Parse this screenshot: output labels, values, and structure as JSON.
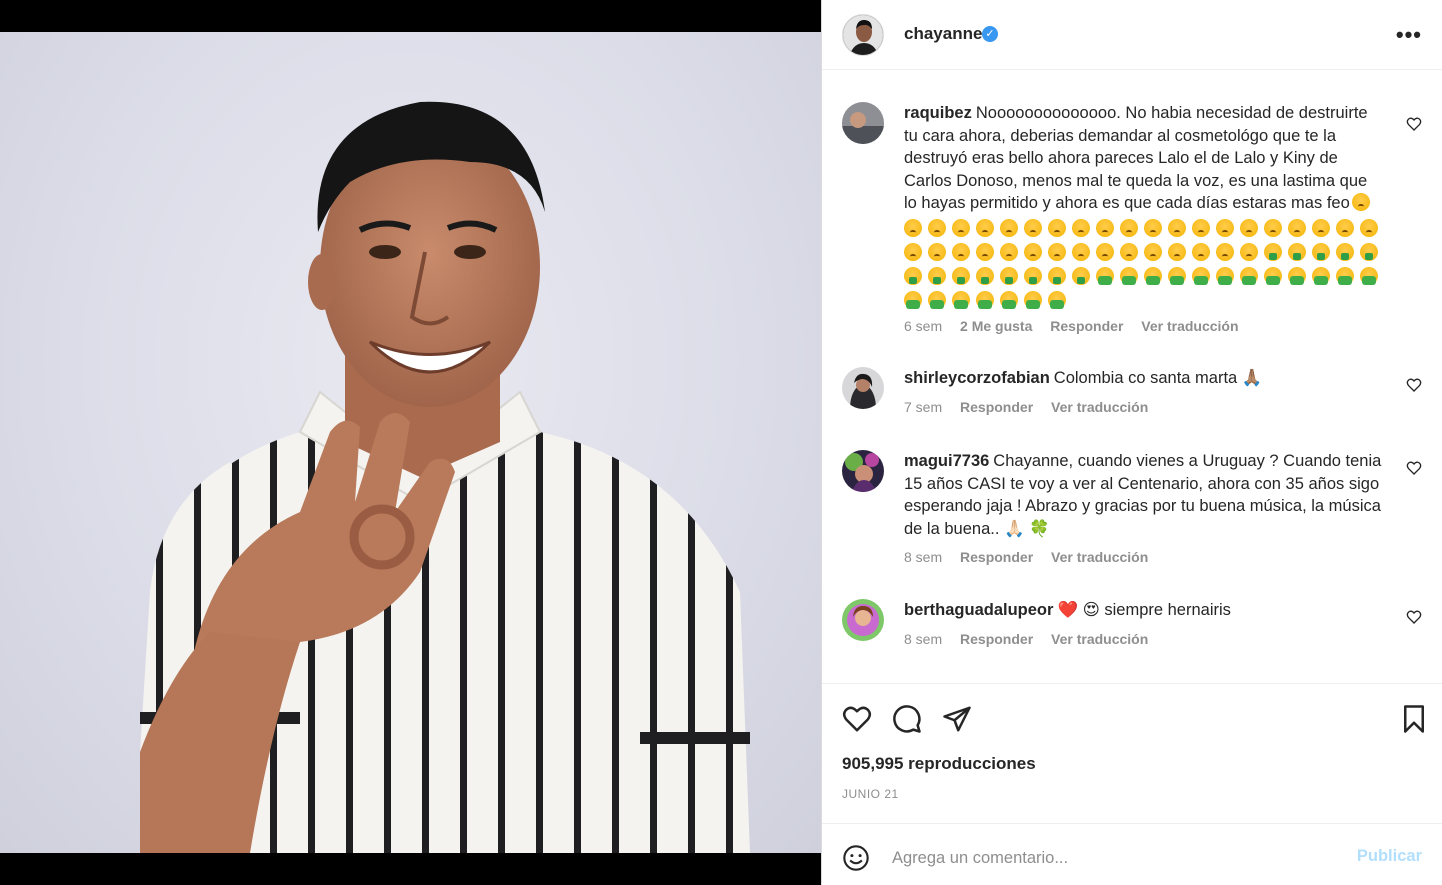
{
  "post": {
    "username": "chayanne",
    "verified_icon": "verified-badge-icon",
    "more_icon": "ellipsis-icon"
  },
  "comments": [
    {
      "username": "raquibez",
      "text": "Noooooooooooooo. No habia necesidad de destruirte tu cara ahora, deberias demandar al cosmetológo que te la destruyó eras bello ahora pareces Lalo el de Lalo y Kiny de Carlos Donoso, menos mal te queda la voz, es una lastima que lo hayas permitido y ahora es que cada días estaras mas feo",
      "emoji_rows": [
        [
          "sad",
          "sad",
          "sad",
          "sad",
          "sad",
          "sad",
          "sad",
          "sad",
          "sad",
          "sad",
          "sad",
          "sad",
          "sad",
          "sad",
          "sad",
          "sad",
          "sad",
          "sad",
          "sad",
          "sad"
        ],
        [
          "sad",
          "sad",
          "sad",
          "sad",
          "sad",
          "sad",
          "sad",
          "sad",
          "sad",
          "sad",
          "sad",
          "sad",
          "sad",
          "sad",
          "sad",
          "money",
          "money",
          "money",
          "money",
          "money"
        ],
        [
          "money",
          "money",
          "money",
          "money",
          "money",
          "money",
          "money",
          "money",
          "sick",
          "sick",
          "sick",
          "sick",
          "sick",
          "sick",
          "sick",
          "sick",
          "sick",
          "sick",
          "sick",
          "sick"
        ],
        [
          "sick",
          "sick",
          "sick",
          "sick",
          "sick",
          "sick",
          "sick"
        ]
      ],
      "time": "6 sem",
      "likes": "2 Me gusta",
      "reply": "Responder",
      "translate": "Ver traducción"
    },
    {
      "username": "shirleycorzofabian",
      "text": "Colombia co santa marta 🙏🏽",
      "time": "7 sem",
      "reply": "Responder",
      "translate": "Ver traducción"
    },
    {
      "username": "magui7736",
      "text": "Chayanne, cuando vienes a Uruguay ? Cuando tenia 15 años CASI te voy a ver al Centenario, ahora con 35 años sigo esperando jaja ! Abrazo y gracias por tu buena música, la música de la buena.. 🙏🏻 🍀",
      "time": "8 sem",
      "reply": "Responder",
      "translate": "Ver traducción"
    },
    {
      "username": "berthaguadalupeor",
      "text": "❤️ 😍 siempre hernairis",
      "time": "8 sem",
      "reply": "Responder",
      "translate": "Ver traducción"
    }
  ],
  "actions": {
    "like_icon": "heart-icon",
    "comment_icon": "comment-bubble-icon",
    "share_icon": "paper-plane-icon",
    "save_icon": "bookmark-icon"
  },
  "views": "905,995 reproducciones",
  "date": "JUNIO 21",
  "add_comment": {
    "placeholder": "Agrega un comentario...",
    "publish_label": "Publicar",
    "publish_color": "#b2dffc"
  },
  "colors": {
    "verified": "#3897f0",
    "muted": "#8e8e8e",
    "text": "#262626"
  }
}
